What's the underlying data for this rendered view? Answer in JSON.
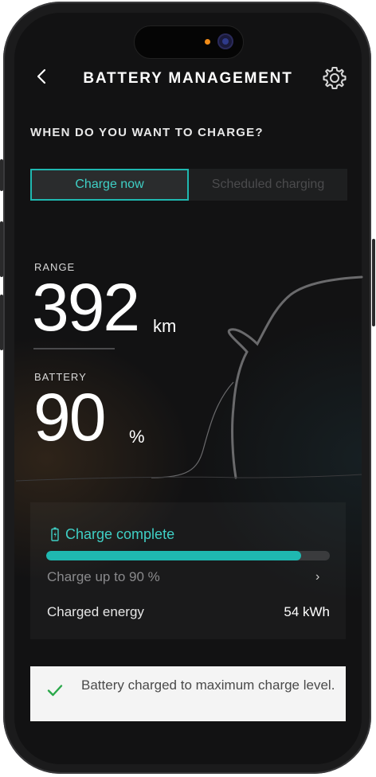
{
  "header": {
    "title": "BATTERY MANAGEMENT",
    "back_icon": "chevron-left-icon",
    "settings_icon": "gear-icon"
  },
  "question": "WHEN DO YOU WANT TO CHARGE?",
  "tabs": [
    {
      "label": "Charge now",
      "selected": true
    },
    {
      "label": "Scheduled charging",
      "selected": false
    }
  ],
  "range": {
    "label": "RANGE",
    "value": "392",
    "unit": "km"
  },
  "battery": {
    "label": "BATTERY",
    "value": "90",
    "unit": "%"
  },
  "charge": {
    "status": "Charge complete",
    "status_icon": "battery-icon",
    "progress_fraction": 0.9,
    "limit_label": "Charge up to 90 %",
    "energy_label": "Charged energy",
    "energy_value": "54 kWh"
  },
  "toast": {
    "message": "Battery charged to maximum charge level.",
    "icon": "checkmark-icon"
  },
  "colors": {
    "accent": "#1fb8b0",
    "background": "#121213",
    "toast_bg": "#f4f4f4",
    "check": "#2aa84a"
  }
}
